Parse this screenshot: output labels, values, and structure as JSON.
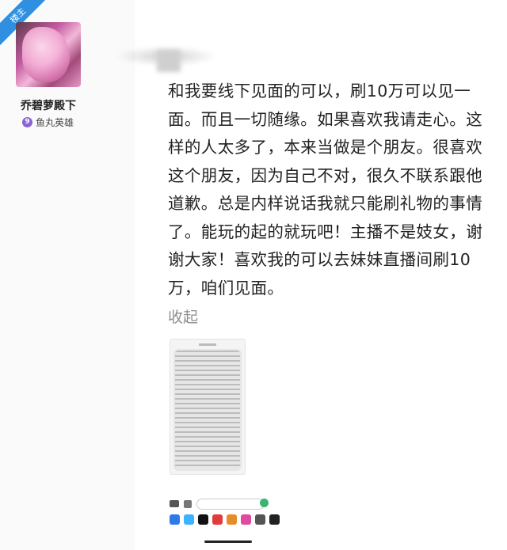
{
  "badge": {
    "label": "楼主"
  },
  "user": {
    "name": "乔碧萝殿下",
    "level_badge": "9",
    "group": "鱼丸英雄"
  },
  "post": {
    "text": "和我要线下见面的可以，刷10万可以见一面。而且一切随缘。如果喜欢我请走心。这样的人太多了，本来当做是个朋友。很喜欢这个朋友，因为自己不对，很久不联系跟他道歉。总是内样说话我就只能刷礼物的事情了。能玩的起的就玩吧！主播不是妓女，谢谢大家！喜欢我的可以去妹妹直播间刷10万，咱们见面。",
    "collapse_label": "收起"
  },
  "colors": {
    "badge": "#2f8fe0",
    "level": "#8a63d2",
    "collapse": "#8d8d8d",
    "send": "#3cb371"
  },
  "icons": [
    "camera-icon",
    "app-store-icon",
    "send-icon"
  ]
}
